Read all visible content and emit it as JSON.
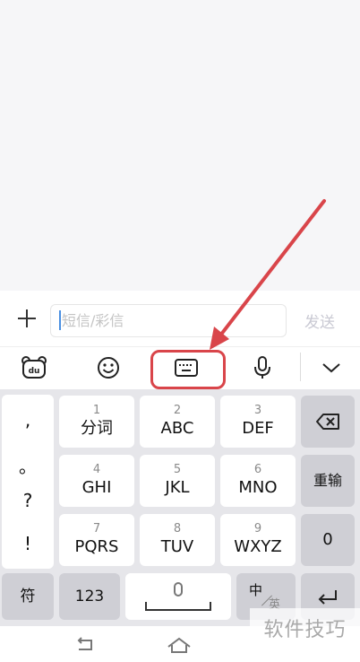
{
  "compose": {
    "input_placeholder": "短信/彩信",
    "send_label": "发送"
  },
  "keyboard": {
    "punctuation": [
      ",",
      "。",
      "?",
      "!"
    ],
    "keys": [
      {
        "num": "1",
        "label": "分词"
      },
      {
        "num": "2",
        "label": "ABC"
      },
      {
        "num": "3",
        "label": "DEF"
      },
      {
        "num": "4",
        "label": "GHI"
      },
      {
        "num": "5",
        "label": "JKL"
      },
      {
        "num": "6",
        "label": "MNO"
      },
      {
        "num": "7",
        "label": "PQRS"
      },
      {
        "num": "8",
        "label": "TUV"
      },
      {
        "num": "9",
        "label": "WXYZ"
      }
    ],
    "retype_label": "重输",
    "zero_label": "0",
    "symbol_label": "符",
    "number_mode_label": "123",
    "lang_zh": "中",
    "lang_en": "英"
  },
  "watermark": "软件技巧",
  "colors": {
    "highlight": "#d9454a",
    "caret": "#4a90e2",
    "send_disabled": "#c9c9d3"
  }
}
